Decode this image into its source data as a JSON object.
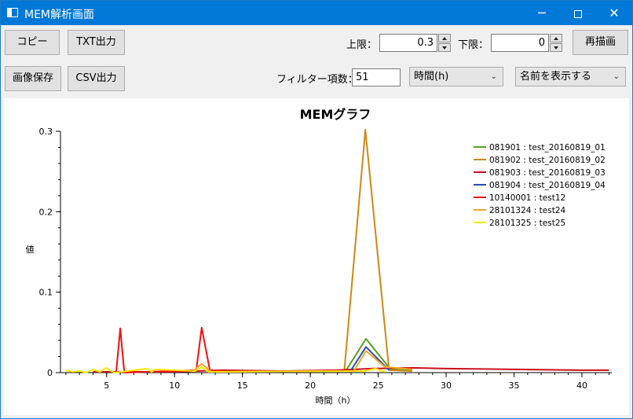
{
  "window": {
    "title": "MEM解析画面",
    "controls": {
      "minimize": "─",
      "close": "✕"
    }
  },
  "toolbar": {
    "copy_label": "コピー",
    "txt_label": "TXT出力",
    "save_image_label": "画像保存",
    "csv_label": "CSV出力",
    "upper_label": "上限：",
    "upper_value": "0.3",
    "lower_label": "下限：",
    "lower_value": "0",
    "redraw_label": "再描画",
    "filter_label": "フィルター項数：",
    "filter_value": "51",
    "xaxis_select": "時間(h)",
    "name_select": "名前を表示する"
  },
  "chart_data": {
    "type": "line",
    "title": "MEMグラフ",
    "xlabel": "時間（h）",
    "ylabel": "値",
    "xlim": [
      1.6,
      42.2
    ],
    "ylim": [
      0,
      0.3
    ],
    "xticks": [
      5,
      10,
      15,
      20,
      25,
      30,
      35,
      40
    ],
    "yticks": [
      0,
      0.1,
      0.2,
      0.3
    ],
    "ytick_labels": [
      "0",
      "0.1",
      "0.2",
      "0.3"
    ],
    "legend_position": "top-right",
    "grid": false,
    "series": [
      {
        "name": "081901 : test_20160819_01",
        "color": "#5a9e1f",
        "x": [
          22.6,
          24.1,
          25.9,
          27.5
        ],
        "y": [
          0.002,
          0.042,
          0.004,
          0.003
        ]
      },
      {
        "name": "081902 : test_20160819_02",
        "color": "#cc8a12",
        "x": [
          22.5,
          24.05,
          25.8,
          27.5
        ],
        "y": [
          0.002,
          0.302,
          0.003,
          0.002
        ]
      },
      {
        "name": "081903 : test_20160819_03",
        "color": "#c8101a",
        "x": [
          4,
          10,
          13.5,
          18,
          22,
          24.5,
          27.5,
          30,
          35,
          40,
          42
        ],
        "y": [
          0.001,
          0.001,
          0.003,
          0.002,
          0.003,
          0.005,
          0.006,
          0.005,
          0.004,
          0.003,
          0.003
        ]
      },
      {
        "name": "081904 : test_20160819_04",
        "color": "#2b4fae",
        "x": [
          23,
          24.1,
          25.8
        ],
        "y": [
          0.003,
          0.032,
          0.003
        ]
      },
      {
        "name": "10140001 : test12",
        "color": "#ee1111",
        "x": [
          5.7,
          6.0,
          6.3,
          11.6,
          12.0,
          12.6,
          13.5
        ],
        "y": [
          0.0,
          0.055,
          0.0,
          0.003,
          0.056,
          0.003,
          0.002
        ]
      },
      {
        "name": "28101324 : test24",
        "color": "#f5a623",
        "x": [
          11.3,
          12.0,
          12.7,
          23.2,
          24.1,
          25.5,
          27.5
        ],
        "y": [
          0.001,
          0.011,
          0.001,
          0.002,
          0.027,
          0.007,
          0.004
        ]
      },
      {
        "name": "28101325 : test25",
        "color": "#ffe600",
        "x": [
          2.0,
          2.5,
          3.0,
          3.5,
          4.0,
          4.5,
          5.0,
          5.3,
          5.6,
          8.0,
          8.3,
          8.6,
          11.5,
          12.0,
          12.5,
          24.0,
          24.8,
          25.5
        ],
        "y": [
          0.003,
          0.001,
          0.002,
          0.0,
          0.004,
          0.001,
          0.006,
          0.002,
          0.0,
          0.005,
          0.001,
          0.004,
          0.002,
          0.007,
          0.001,
          0.002,
          0.005,
          0.001
        ]
      }
    ]
  }
}
